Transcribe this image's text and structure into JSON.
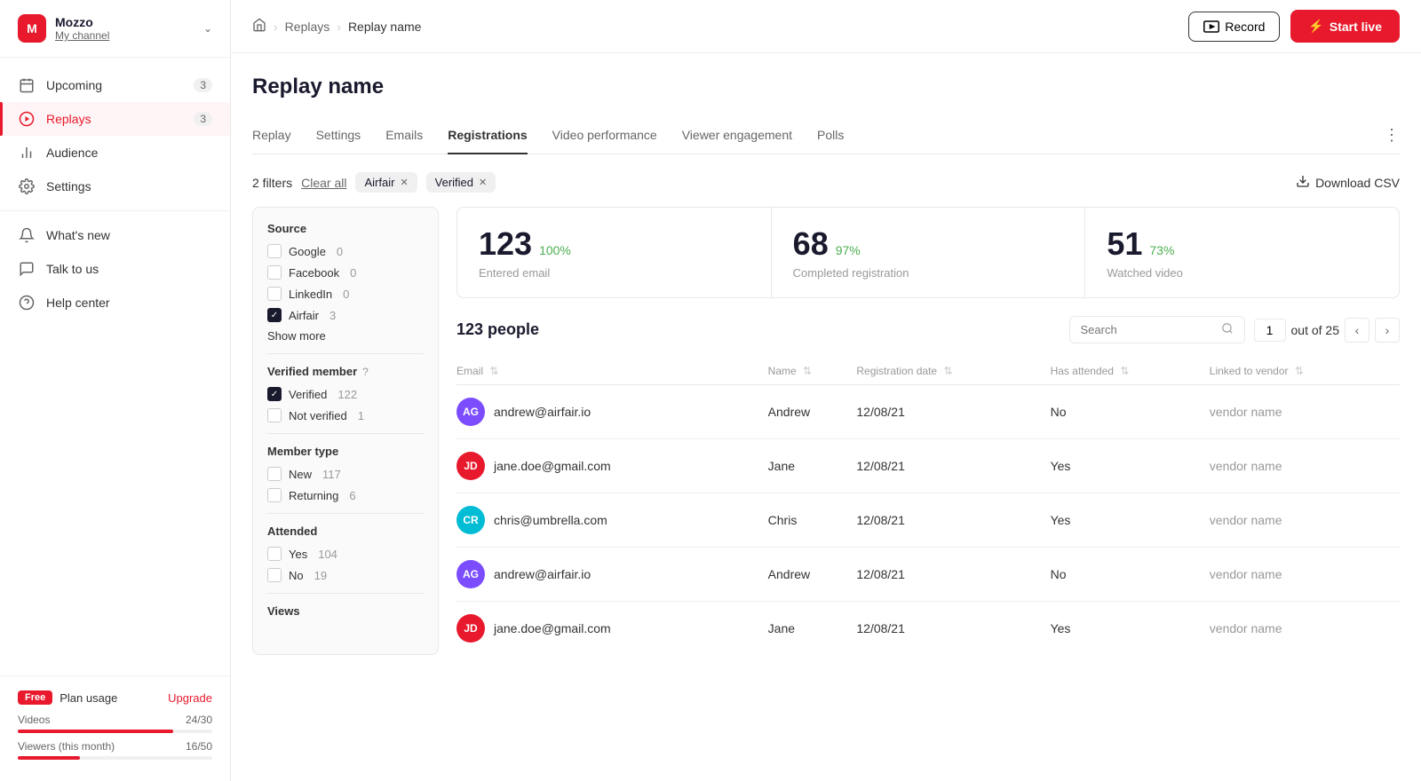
{
  "sidebar": {
    "logo": "M",
    "user": {
      "name": "Mozzo",
      "channel": "My channel"
    },
    "nav": [
      {
        "id": "upcoming",
        "label": "Upcoming",
        "icon": "calendar",
        "badge": "3",
        "active": false
      },
      {
        "id": "replays",
        "label": "Replays",
        "icon": "play-circle",
        "badge": "3",
        "active": true
      },
      {
        "id": "audience",
        "label": "Audience",
        "icon": "bar-chart",
        "badge": "",
        "active": false
      },
      {
        "id": "settings",
        "label": "Settings",
        "icon": "gear",
        "badge": "",
        "active": false
      }
    ],
    "secondary": [
      {
        "id": "whats-new",
        "label": "What's new",
        "icon": "bell"
      },
      {
        "id": "talk-to-us",
        "label": "Talk to us",
        "icon": "chat"
      },
      {
        "id": "help-center",
        "label": "Help center",
        "icon": "help-circle"
      }
    ],
    "plan": {
      "badge": "Free",
      "label": "Plan usage",
      "upgrade": "Upgrade"
    },
    "usage": [
      {
        "label": "Videos",
        "value": "24/30",
        "pct": 80
      },
      {
        "label": "Viewers (this month)",
        "value": "16/50",
        "pct": 32
      }
    ]
  },
  "topbar": {
    "breadcrumbs": [
      "Home",
      "Replays",
      "Replay name"
    ],
    "record_label": "Record",
    "start_live_label": "Start live"
  },
  "page": {
    "title": "Replay name",
    "tabs": [
      "Replay",
      "Settings",
      "Emails",
      "Registrations",
      "Video performance",
      "Viewer engagement",
      "Polls"
    ],
    "active_tab": "Registrations"
  },
  "filters": {
    "count": "2 filters",
    "clear_all": "Clear all",
    "active_tags": [
      "Airfair",
      "Verified"
    ],
    "download_csv": "Download CSV",
    "source": {
      "title": "Source",
      "options": [
        {
          "label": "Google",
          "count": "0",
          "checked": false
        },
        {
          "label": "Facebook",
          "count": "0",
          "checked": false
        },
        {
          "label": "LinkedIn",
          "count": "0",
          "checked": false
        },
        {
          "label": "Airfair",
          "count": "3",
          "checked": true
        }
      ],
      "show_more": "Show more"
    },
    "verified": {
      "title": "Verified member",
      "options": [
        {
          "label": "Verified",
          "count": "122",
          "checked": true
        },
        {
          "label": "Not verified",
          "count": "1",
          "checked": false
        }
      ]
    },
    "member_type": {
      "title": "Member type",
      "options": [
        {
          "label": "New",
          "count": "117",
          "checked": false
        },
        {
          "label": "Returning",
          "count": "6",
          "checked": false
        }
      ]
    },
    "attended": {
      "title": "Attended",
      "options": [
        {
          "label": "Yes",
          "count": "104",
          "checked": false
        },
        {
          "label": "No",
          "count": "19",
          "checked": false
        }
      ]
    },
    "views": {
      "title": "Views"
    }
  },
  "stats": [
    {
      "number": "123",
      "pct": "100%",
      "label": "Entered email"
    },
    {
      "number": "68",
      "pct": "97%",
      "label": "Completed registration"
    },
    {
      "number": "51",
      "pct": "73%",
      "label": "Watched video"
    }
  ],
  "people": {
    "count": "123 people",
    "search_placeholder": "Search",
    "page_current": "1",
    "page_total": "out of 25",
    "columns": [
      "Email",
      "Name",
      "Registration date",
      "Has attended",
      "Linked to vendor"
    ],
    "rows": [
      {
        "avatar": "AG",
        "av_class": "av-ag",
        "email": "andrew@airfair.io",
        "name": "Andrew",
        "date": "12/08/21",
        "attended": "No",
        "vendor": "vendor name"
      },
      {
        "avatar": "JD",
        "av_class": "av-jd",
        "email": "jane.doe@gmail.com",
        "name": "Jane",
        "date": "12/08/21",
        "attended": "Yes",
        "vendor": "vendor name"
      },
      {
        "avatar": "CR",
        "av_class": "av-cr",
        "email": "chris@umbrella.com",
        "name": "Chris",
        "date": "12/08/21",
        "attended": "Yes",
        "vendor": "vendor name"
      },
      {
        "avatar": "AG",
        "av_class": "av-ag",
        "email": "andrew@airfair.io",
        "name": "Andrew",
        "date": "12/08/21",
        "attended": "No",
        "vendor": "vendor name"
      },
      {
        "avatar": "JD",
        "av_class": "av-jd",
        "email": "jane.doe@gmail.com",
        "name": "Jane",
        "date": "12/08/21",
        "attended": "Yes",
        "vendor": "vendor name"
      }
    ]
  }
}
